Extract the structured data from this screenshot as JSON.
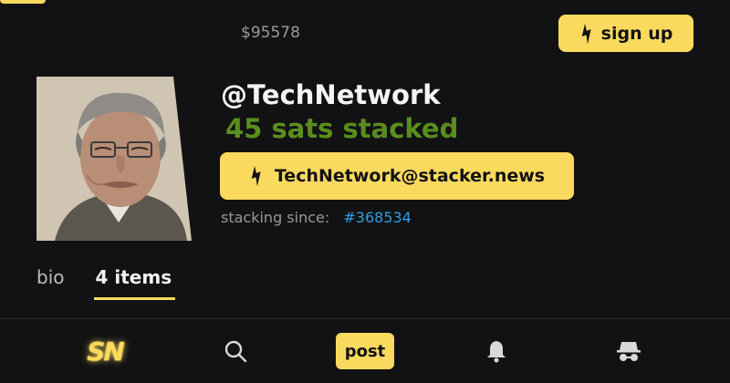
{
  "header": {
    "price": "$95578",
    "signup_label": "sign up"
  },
  "profile": {
    "username": "@TechNetwork",
    "sats": "45 sats stacked",
    "lightning_address": "TechNetwork@stacker.news",
    "since_label": "stacking since:",
    "since_value": "#368534"
  },
  "tabs": [
    {
      "label": "bio",
      "active": false
    },
    {
      "label": "4 items",
      "active": true
    }
  ],
  "bottom_nav": {
    "logo": "SN",
    "post_label": "post",
    "icons": [
      "home-logo-icon",
      "search-icon",
      "post-button",
      "bell-icon",
      "incognito-icon"
    ]
  },
  "colors": {
    "accent": "#fada5e",
    "background": "#121214",
    "sats_green": "#5a8e1e",
    "link_blue": "#2f9ee0"
  }
}
